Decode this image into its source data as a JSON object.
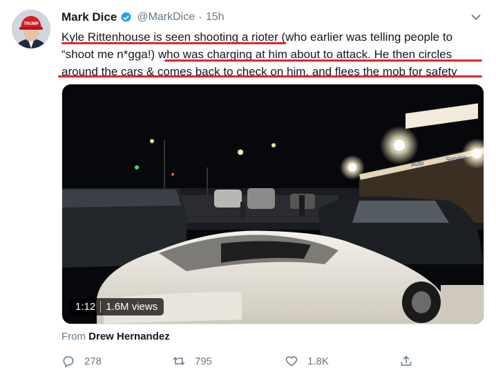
{
  "tweet": {
    "display_name": "Mark Dice",
    "handle": "@MarkDice",
    "separator": "·",
    "time": "15h",
    "lines": [
      "Kyle Rittenhouse is seen shooting a rioter (who earlier was telling people to",
      "“shoot me n*gga!) who was charging at him about to attack.  He then circles",
      "around the cars & comes back to check on him, and flees the mob for safety"
    ],
    "avatar_hat_text": "TRUMP",
    "underline_color": "#e0242a",
    "verified_color": "#1da1f2"
  },
  "video": {
    "duration": "1:12",
    "views": "1.6M views",
    "sign_1": "Auto",
    "sign_2": "Service"
  },
  "attribution": {
    "prefix": "From",
    "source": "Drew Hernandez"
  },
  "actions": {
    "reply_count": "278",
    "retweet_count": "795",
    "like_count": "1.8K"
  }
}
